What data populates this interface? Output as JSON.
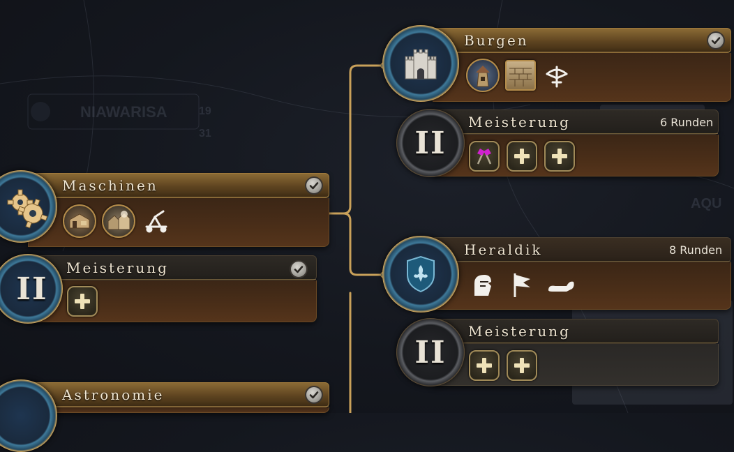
{
  "colors": {
    "gold_bar": "#8a6a35",
    "brown_body": "#4a2e18",
    "grey_body": "#33302c",
    "connector": "#c9a15a",
    "text": "#f0e6d2",
    "flag_magenta": "#d020d0"
  },
  "background": {
    "faded_label": "NIAWARISA",
    "faded_num_1": "19",
    "faded_num_2": "31",
    "faded_right": "AQU"
  },
  "nodes": {
    "maschinen": {
      "title": "Maschinen",
      "completed": true,
      "icons": [
        "workshop-building-icon",
        "forge-building-icon",
        "catapult-unit-icon"
      ]
    },
    "maschinen_mastery": {
      "title": "Meisterung",
      "completed": true,
      "roman": "II",
      "icons": [
        "plus-icon"
      ]
    },
    "astronomie": {
      "title": "Astronomie",
      "completed": true
    },
    "burgen": {
      "title": "Burgen",
      "completed": true,
      "icons": [
        "tower-building-icon",
        "wall-building-icon",
        "crossbow-unit-icon"
      ]
    },
    "burgen_mastery": {
      "title": "Meisterung",
      "turns": "6 Runden",
      "roman": "II",
      "icons": [
        "flag-icon",
        "plus-icon",
        "plus-icon"
      ]
    },
    "heraldik": {
      "title": "Heraldik",
      "turns": "8 Runden",
      "icons": [
        "knight-helmet-icon",
        "banner-flag-icon",
        "horn-icon"
      ]
    },
    "heraldik_mastery": {
      "title": "Meisterung",
      "roman": "II",
      "icons": [
        "plus-icon",
        "plus-icon"
      ]
    }
  }
}
